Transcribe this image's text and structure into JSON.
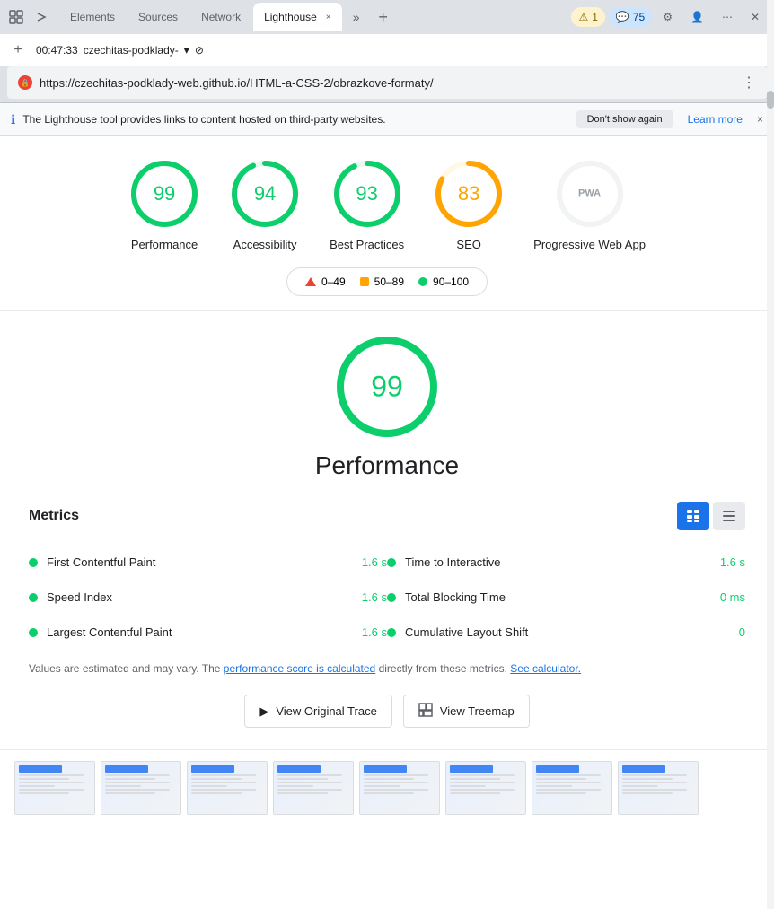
{
  "browser": {
    "tabs": [
      {
        "label": "Elements",
        "active": false
      },
      {
        "label": "Sources",
        "active": false
      },
      {
        "label": "Network",
        "active": false
      },
      {
        "label": "Lighthouse",
        "active": true
      },
      {
        "label": "more",
        "active": false
      }
    ],
    "warning_badge": "1",
    "error_badge": "75",
    "new_tab_label": "+",
    "more_label": "⋯"
  },
  "toolbar": {
    "time": "00:47:33",
    "domain": "czechitas-podklady-",
    "dropdown_icon": "▾",
    "cancel_icon": "⊘"
  },
  "url_bar": {
    "url": "https://czechitas-podklady-web.github.io/HTML-a-CSS-2/obrazkove-formaty/",
    "menu_icon": "⋮"
  },
  "notification": {
    "text": "The Lighthouse tool provides links to content hosted on third-party websites.",
    "button": "Don't show again",
    "learn_more": "Learn more",
    "close": "×"
  },
  "scores": [
    {
      "value": 99,
      "label": "Performance",
      "color": "#0cce6b",
      "ring_color": "#0cce6b",
      "bg_color": "#e6faf0"
    },
    {
      "value": 94,
      "label": "Accessibility",
      "color": "#0cce6b",
      "ring_color": "#0cce6b",
      "bg_color": "#e6faf0"
    },
    {
      "value": 93,
      "label": "Best Practices",
      "color": "#0cce6b",
      "ring_color": "#0cce6b",
      "bg_color": "#e6faf0"
    },
    {
      "value": 83,
      "label": "SEO",
      "color": "#ffa400",
      "ring_color": "#ffa400",
      "bg_color": "#fff8e6"
    },
    {
      "value": null,
      "label": "Progressive Web App",
      "color": "#9aa0a6",
      "ring_color": "#9aa0a6",
      "bg_color": "#f1f3f4"
    }
  ],
  "legend": [
    {
      "type": "triangle",
      "color": "#ea4335",
      "range": "0–49"
    },
    {
      "type": "square",
      "color": "#ffa400",
      "range": "50–89"
    },
    {
      "type": "dot",
      "color": "#0cce6b",
      "range": "90–100"
    }
  ],
  "performance": {
    "score": "99",
    "title": "Performance"
  },
  "metrics_section": {
    "title": "Metrics",
    "view_list_icon": "≡",
    "view_grid_icon": "⊞",
    "items_left": [
      {
        "name": "First Contentful Paint",
        "value": "1.6 s",
        "color": "#0cce6b"
      },
      {
        "name": "Speed Index",
        "value": "1.6 s",
        "color": "#0cce6b"
      },
      {
        "name": "Largest Contentful Paint",
        "value": "1.6 s",
        "color": "#0cce6b"
      }
    ],
    "items_right": [
      {
        "name": "Time to Interactive",
        "value": "1.6 s",
        "color": "#0cce6b"
      },
      {
        "name": "Total Blocking Time",
        "value": "0 ms",
        "color": "#0cce6b"
      },
      {
        "name": "Cumulative Layout Shift",
        "value": "0",
        "color": "#0cce6b"
      }
    ],
    "note": "Values are estimated and may vary. The",
    "note_link1": "performance score is calculated",
    "note_mid": "directly from these metrics.",
    "note_link2": "See calculator."
  },
  "action_buttons": [
    {
      "label": "View Original Trace",
      "icon": ""
    },
    {
      "label": "View Treemap",
      "icon": "⊞"
    }
  ],
  "thumbnails_count": 8
}
